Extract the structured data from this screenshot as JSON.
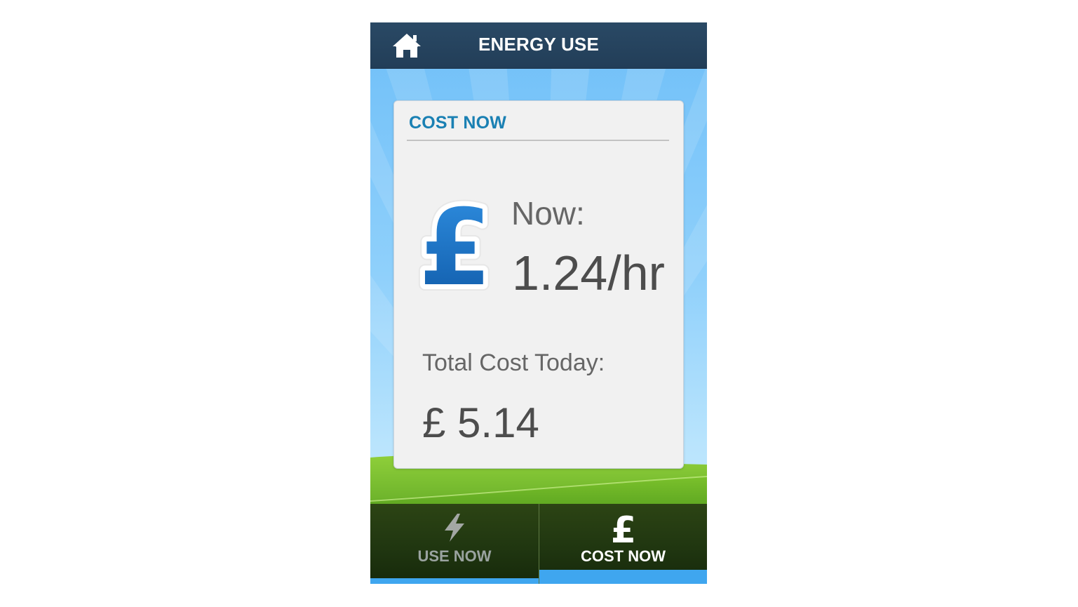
{
  "header": {
    "title": "ENERGY USE",
    "home_icon": "home-icon"
  },
  "card": {
    "title": "COST NOW",
    "currency_icon": "pound-icon",
    "now_label": "Now:",
    "now_value": "1.24/hr",
    "total_label": "Total Cost Today:",
    "total_value": "£ 5.14"
  },
  "tabs": [
    {
      "label": "USE NOW",
      "icon": "lightning-icon",
      "active": false
    },
    {
      "label": "COST NOW",
      "icon": "pound-icon",
      "active": true
    }
  ],
  "colors": {
    "header_bg": "#223e58",
    "accent_title": "#1a80b3",
    "pound_blue": "#1a6fc4",
    "tab_indicator": "#3fa6ef",
    "tab_bg": "#1f3510"
  }
}
